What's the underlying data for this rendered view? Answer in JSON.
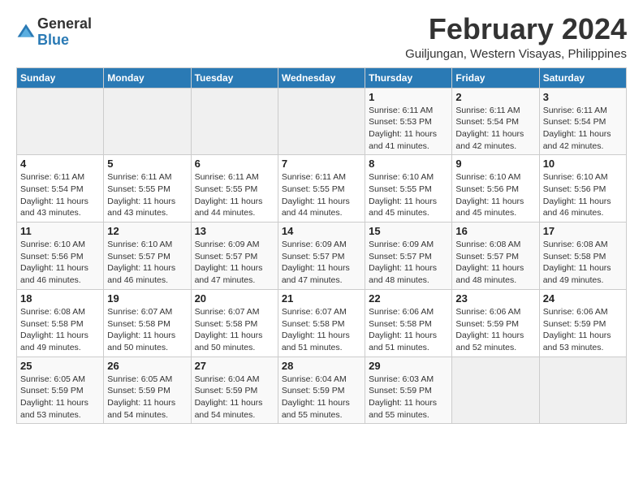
{
  "logo": {
    "general": "General",
    "blue": "Blue"
  },
  "title": {
    "month": "February 2024",
    "location": "Guiljungan, Western Visayas, Philippines"
  },
  "headers": [
    "Sunday",
    "Monday",
    "Tuesday",
    "Wednesday",
    "Thursday",
    "Friday",
    "Saturday"
  ],
  "weeks": [
    [
      {
        "day": "",
        "info": ""
      },
      {
        "day": "",
        "info": ""
      },
      {
        "day": "",
        "info": ""
      },
      {
        "day": "",
        "info": ""
      },
      {
        "day": "1",
        "info": "Sunrise: 6:11 AM\nSunset: 5:53 PM\nDaylight: 11 hours\nand 41 minutes."
      },
      {
        "day": "2",
        "info": "Sunrise: 6:11 AM\nSunset: 5:54 PM\nDaylight: 11 hours\nand 42 minutes."
      },
      {
        "day": "3",
        "info": "Sunrise: 6:11 AM\nSunset: 5:54 PM\nDaylight: 11 hours\nand 42 minutes."
      }
    ],
    [
      {
        "day": "4",
        "info": "Sunrise: 6:11 AM\nSunset: 5:54 PM\nDaylight: 11 hours\nand 43 minutes."
      },
      {
        "day": "5",
        "info": "Sunrise: 6:11 AM\nSunset: 5:55 PM\nDaylight: 11 hours\nand 43 minutes."
      },
      {
        "day": "6",
        "info": "Sunrise: 6:11 AM\nSunset: 5:55 PM\nDaylight: 11 hours\nand 44 minutes."
      },
      {
        "day": "7",
        "info": "Sunrise: 6:11 AM\nSunset: 5:55 PM\nDaylight: 11 hours\nand 44 minutes."
      },
      {
        "day": "8",
        "info": "Sunrise: 6:10 AM\nSunset: 5:55 PM\nDaylight: 11 hours\nand 45 minutes."
      },
      {
        "day": "9",
        "info": "Sunrise: 6:10 AM\nSunset: 5:56 PM\nDaylight: 11 hours\nand 45 minutes."
      },
      {
        "day": "10",
        "info": "Sunrise: 6:10 AM\nSunset: 5:56 PM\nDaylight: 11 hours\nand 46 minutes."
      }
    ],
    [
      {
        "day": "11",
        "info": "Sunrise: 6:10 AM\nSunset: 5:56 PM\nDaylight: 11 hours\nand 46 minutes."
      },
      {
        "day": "12",
        "info": "Sunrise: 6:10 AM\nSunset: 5:57 PM\nDaylight: 11 hours\nand 46 minutes."
      },
      {
        "day": "13",
        "info": "Sunrise: 6:09 AM\nSunset: 5:57 PM\nDaylight: 11 hours\nand 47 minutes."
      },
      {
        "day": "14",
        "info": "Sunrise: 6:09 AM\nSunset: 5:57 PM\nDaylight: 11 hours\nand 47 minutes."
      },
      {
        "day": "15",
        "info": "Sunrise: 6:09 AM\nSunset: 5:57 PM\nDaylight: 11 hours\nand 48 minutes."
      },
      {
        "day": "16",
        "info": "Sunrise: 6:08 AM\nSunset: 5:57 PM\nDaylight: 11 hours\nand 48 minutes."
      },
      {
        "day": "17",
        "info": "Sunrise: 6:08 AM\nSunset: 5:58 PM\nDaylight: 11 hours\nand 49 minutes."
      }
    ],
    [
      {
        "day": "18",
        "info": "Sunrise: 6:08 AM\nSunset: 5:58 PM\nDaylight: 11 hours\nand 49 minutes."
      },
      {
        "day": "19",
        "info": "Sunrise: 6:07 AM\nSunset: 5:58 PM\nDaylight: 11 hours\nand 50 minutes."
      },
      {
        "day": "20",
        "info": "Sunrise: 6:07 AM\nSunset: 5:58 PM\nDaylight: 11 hours\nand 50 minutes."
      },
      {
        "day": "21",
        "info": "Sunrise: 6:07 AM\nSunset: 5:58 PM\nDaylight: 11 hours\nand 51 minutes."
      },
      {
        "day": "22",
        "info": "Sunrise: 6:06 AM\nSunset: 5:58 PM\nDaylight: 11 hours\nand 51 minutes."
      },
      {
        "day": "23",
        "info": "Sunrise: 6:06 AM\nSunset: 5:59 PM\nDaylight: 11 hours\nand 52 minutes."
      },
      {
        "day": "24",
        "info": "Sunrise: 6:06 AM\nSunset: 5:59 PM\nDaylight: 11 hours\nand 53 minutes."
      }
    ],
    [
      {
        "day": "25",
        "info": "Sunrise: 6:05 AM\nSunset: 5:59 PM\nDaylight: 11 hours\nand 53 minutes."
      },
      {
        "day": "26",
        "info": "Sunrise: 6:05 AM\nSunset: 5:59 PM\nDaylight: 11 hours\nand 54 minutes."
      },
      {
        "day": "27",
        "info": "Sunrise: 6:04 AM\nSunset: 5:59 PM\nDaylight: 11 hours\nand 54 minutes."
      },
      {
        "day": "28",
        "info": "Sunrise: 6:04 AM\nSunset: 5:59 PM\nDaylight: 11 hours\nand 55 minutes."
      },
      {
        "day": "29",
        "info": "Sunrise: 6:03 AM\nSunset: 5:59 PM\nDaylight: 11 hours\nand 55 minutes."
      },
      {
        "day": "",
        "info": ""
      },
      {
        "day": "",
        "info": ""
      }
    ]
  ]
}
